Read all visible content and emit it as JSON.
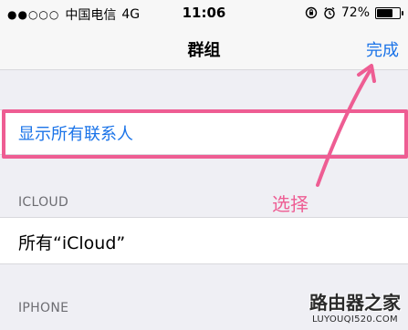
{
  "status_bar": {
    "signal": "●●○○○",
    "carrier": "中国电信",
    "network": "4G",
    "time": "11:06",
    "battery": "72%",
    "battery_level": 0.72
  },
  "nav": {
    "title": "群组",
    "done_label": "完成"
  },
  "rows": {
    "show_all": "显示所有联系人",
    "icloud_all": "所有“iCloud”"
  },
  "sections": {
    "icloud": "ICLOUD",
    "iphone": "IPHONE"
  },
  "annotation": {
    "text": "选择",
    "color": "#ee5d93"
  },
  "watermark": {
    "title": "路由器之家",
    "url": "LUYOUQI520.COM"
  }
}
